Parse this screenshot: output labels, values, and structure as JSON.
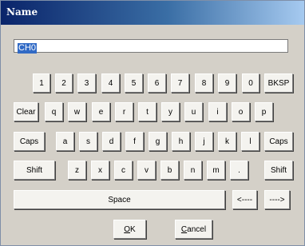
{
  "window": {
    "title": "Name"
  },
  "name_input": {
    "value": "CH0"
  },
  "keyboard": {
    "row1": [
      "1",
      "2",
      "3",
      "4",
      "5",
      "6",
      "7",
      "8",
      "9",
      "0",
      "BKSP"
    ],
    "row2": [
      "Clear",
      "q",
      "w",
      "e",
      "r",
      "t",
      "y",
      "u",
      "i",
      "o",
      "p"
    ],
    "row3": [
      "Caps",
      "a",
      "s",
      "d",
      "f",
      "g",
      "h",
      "j",
      "k",
      "l",
      "Caps"
    ],
    "row4": [
      "Shift",
      "z",
      "x",
      "c",
      "v",
      "b",
      "n",
      "m",
      ".",
      "Shift"
    ],
    "row5": [
      "Space",
      "<----",
      "---->"
    ]
  },
  "buttons": {
    "ok": "OK",
    "cancel": "Cancel"
  }
}
